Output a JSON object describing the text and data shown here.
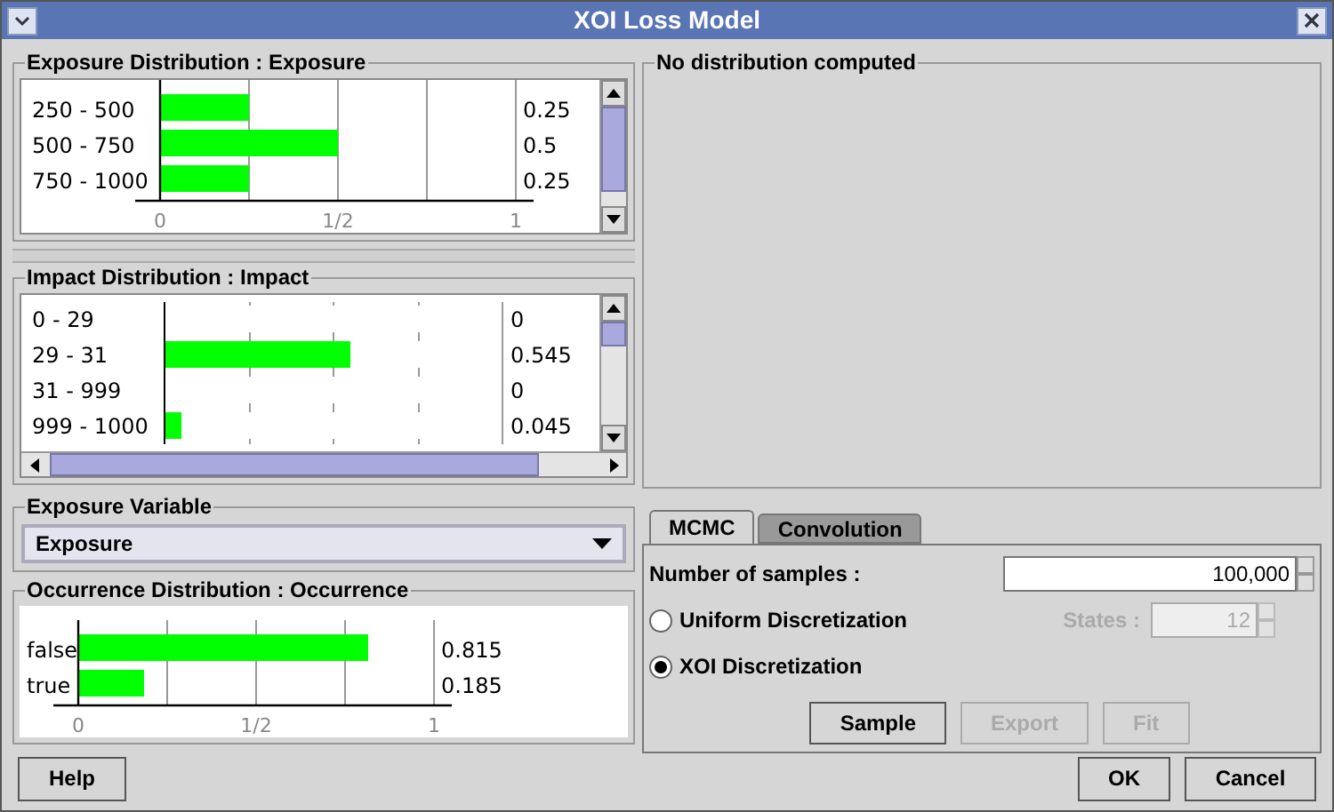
{
  "window": {
    "title": "XOI Loss Model"
  },
  "exposure_distribution": {
    "title": "Exposure Distribution : Exposure",
    "chart_data": {
      "type": "bar",
      "orientation": "horizontal",
      "categories": [
        "250 - 500",
        "500 - 750",
        "750 - 1000"
      ],
      "values": [
        0.25,
        0.5,
        0.25
      ],
      "xlim": [
        0,
        1
      ],
      "xticks": [
        {
          "value": 0,
          "label": "0"
        },
        {
          "value": 0.5,
          "label": "1/2"
        },
        {
          "value": 1,
          "label": "1"
        }
      ]
    },
    "value_column": [
      "0.25",
      "0.5",
      "0.25"
    ]
  },
  "impact_distribution": {
    "title": "Impact Distribution : Impact",
    "rows": [
      {
        "label": "0 - 29",
        "level": 0,
        "value": "0"
      },
      {
        "label": "29 - 31",
        "level": 0.545,
        "value": "0.545"
      },
      {
        "label": "31 - 999",
        "level": 0,
        "value": "0"
      },
      {
        "label": "999 - 1000",
        "level": 0.045,
        "value": "0.045"
      }
    ]
  },
  "exposure_variable": {
    "title": "Exposure Variable",
    "value": "Exposure"
  },
  "occurrence_distribution": {
    "title": "Occurrence Distribution : Occurrence",
    "chart_data": {
      "type": "bar",
      "orientation": "horizontal",
      "categories": [
        "false",
        "true"
      ],
      "values": [
        0.815,
        0.185
      ],
      "xlim": [
        0,
        1
      ],
      "xticks": [
        {
          "value": 0,
          "label": "0"
        },
        {
          "value": 0.5,
          "label": "1/2"
        },
        {
          "value": 1,
          "label": "1"
        }
      ],
      "value_labels": [
        "0.815",
        "0.185"
      ]
    }
  },
  "result_panel": {
    "title": "No distribution computed"
  },
  "tabs": [
    {
      "label": "MCMC",
      "selected": true
    },
    {
      "label": "Convolution",
      "selected": false
    }
  ],
  "samples": {
    "label": "Number of samples :",
    "value": "100,000"
  },
  "discretization": [
    {
      "label": "Uniform Discretization",
      "selected": false
    },
    {
      "label": "XOI Discretization",
      "selected": true
    }
  ],
  "states": {
    "label": "States :",
    "value": "12",
    "disabled": true
  },
  "action_buttons": [
    {
      "label": "Sample",
      "disabled": false
    },
    {
      "label": "Export",
      "disabled": true
    },
    {
      "label": "Fit",
      "disabled": true
    }
  ],
  "footer_buttons": [
    {
      "label": "Help"
    },
    {
      "label": "OK"
    },
    {
      "label": "Cancel"
    }
  ]
}
